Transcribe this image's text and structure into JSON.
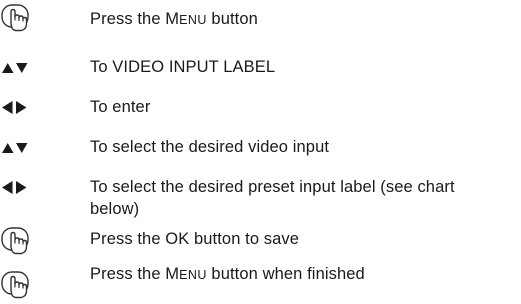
{
  "steps": [
    {
      "icon": "hand-press-icon",
      "text_before": "Press the ",
      "key_first": "M",
      "key_rest": "ENU",
      "text_after": " button"
    },
    {
      "icon": "up-down-arrows-icon",
      "text": "To VIDEO INPUT LABEL"
    },
    {
      "icon": "left-right-arrows-icon",
      "text": "To enter"
    },
    {
      "icon": "up-down-arrows-icon",
      "text": "To select the desired video input"
    },
    {
      "icon": "left-right-arrows-icon",
      "text": "To select the desired preset input label (see chart below)"
    },
    {
      "icon": "hand-press-icon",
      "text": "Press the OK button to save"
    },
    {
      "icon": "hand-press-icon",
      "text_before": "Press the ",
      "key_first": "M",
      "key_rest": "ENU",
      "text_after": " button when finished"
    }
  ]
}
